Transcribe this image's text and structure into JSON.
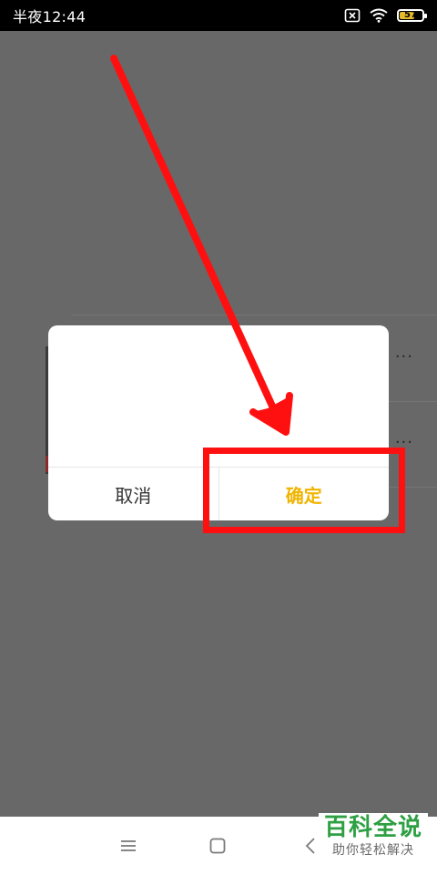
{
  "status_bar": {
    "time": "半夜12:44",
    "battery": "57",
    "icons": [
      "sim-x-icon",
      "wifi-icon",
      "battery-icon"
    ]
  },
  "dialog": {
    "cancel_label": "取消",
    "confirm_label": "确定"
  },
  "nav_bar": {
    "icons": [
      "menu-icon",
      "home-icon",
      "back-icon"
    ]
  },
  "watermark": {
    "title": "百科全说",
    "subtitle": "助你轻松解决"
  },
  "colors": {
    "confirm": "#f0b400",
    "annotation": "#ff1010",
    "overlay": "#686868",
    "watermark": "#2ea043"
  }
}
